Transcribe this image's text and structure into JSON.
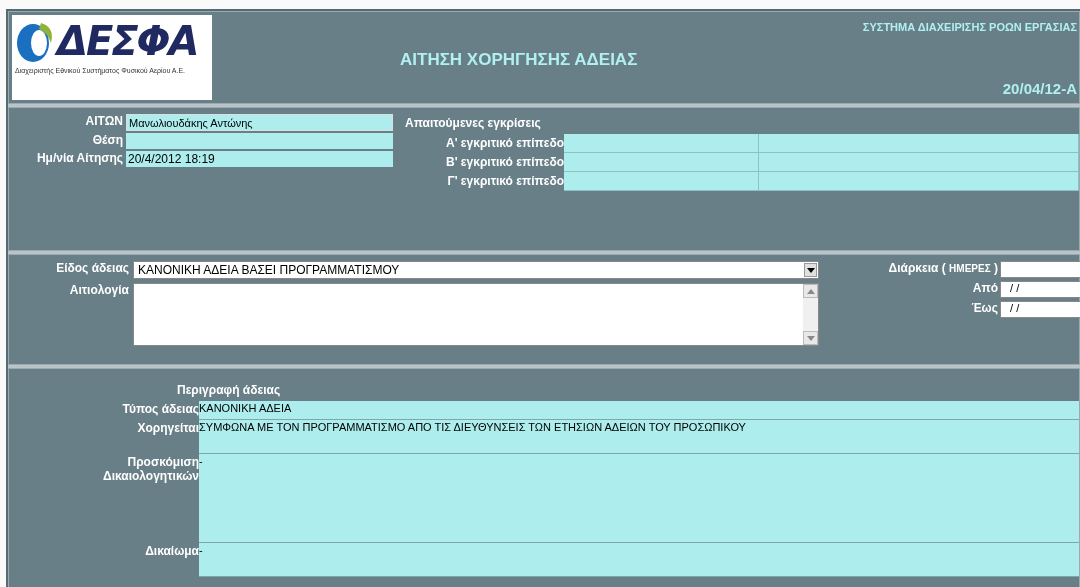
{
  "header": {
    "logo": {
      "name": "ΔΕΣΦΑ",
      "subtitle": "Διαχειριστής Εθνικού Συστήματος Φυσικού Αερίου Α.Ε."
    },
    "title": "ΑΙΤΗΣΗ ΧΟΡΗΓΗΣΗΣ ΑΔΕΙΑΣ",
    "system": "ΣΥΣΤΗΜΑ ΔΙΑΧΕΙΡΙΣΗΣ ΡΟΩΝ ΕΡΓΑΣΙΑΣ",
    "code": "20/04/12-A"
  },
  "applicant": {
    "fields": [
      {
        "label": "ΑΙΤΩΝ",
        "value": "Μανωλιουδάκης Αντώνης",
        "kind": "boxed"
      },
      {
        "label": "Θέση",
        "kind": "plain"
      },
      {
        "label": "Ημ/νία Αίτησης",
        "value": "20/4/2012 18:19",
        "kind": "plain"
      }
    ],
    "approvals_title": "Απαιτούμενες εγκρίσεις",
    "approvals": [
      {
        "label": "Α' εγκριτικό επίπεδο"
      },
      {
        "label": "Β' εγκριτικό επίπεδο"
      },
      {
        "label": "Γ' εγκριτικό επίπεδο"
      }
    ]
  },
  "leave": {
    "type_label": "Είδος άδειας",
    "type_value": "ΚΑΝΟΝΙΚΗ ΑΔΕΙΑ ΒΑΣΕΙ ΠΡΟΓΡΑΜΜΑΤΙΣΜΟΥ",
    "reason_label": "Αιτιολογία",
    "duration_label": "Διάρκεια (",
    "duration_unit": "ΗΜΕΡΕΣ",
    "duration_close": ")",
    "dates": [
      {
        "label": "Από",
        "value": " / /"
      },
      {
        "label": "Έως",
        "value": " / /"
      }
    ]
  },
  "description": {
    "title": "Περιγραφή άδειας",
    "rows": [
      {
        "label": "Τύπος άδειας",
        "value": "ΚΑΝΟΝΙΚΗ ΑΔΕΙΑ"
      },
      {
        "label": "Χορηγείται",
        "value": "ΣΥΜΦΩΝΑ ΜΕ ΤΟΝ ΠΡΟΓΡΑΜΜΑΤΙΣΜΟ ΑΠΟ ΤΙΣ ΔΙΕΥΘΥΝΣΕΙΣ ΤΩΝ ΕΤΗΣΙΩΝ ΑΔΕΙΩΝ ΤΟΥ ΠΡΟΣΩΠΙΚΟΥ"
      },
      {
        "label": "Προσκόμιση Δικαιολογητικών",
        "value": "-"
      },
      {
        "label": "Δικαίωμα",
        "value": "-"
      }
    ]
  }
}
